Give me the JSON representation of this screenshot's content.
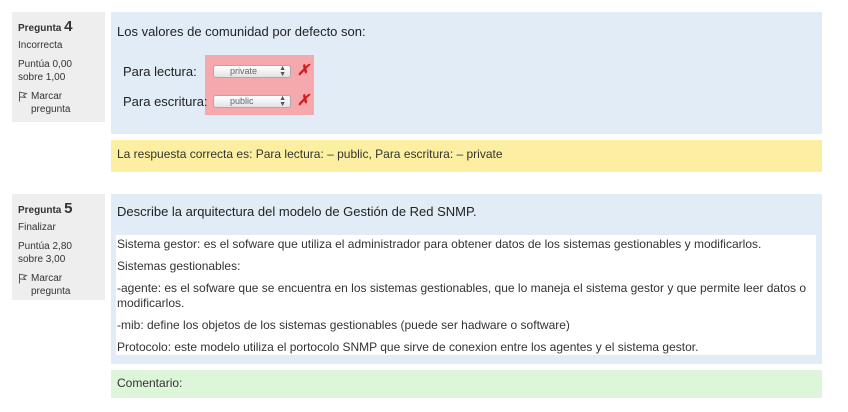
{
  "q4": {
    "label": "Pregunta",
    "number": "4",
    "state": "Incorrecta",
    "grade": "Puntúa 0,00 sobre 1,00",
    "flag_label": "Marcar pregunta",
    "question_text": "Los valores de comunidad por defecto son:",
    "rows": [
      {
        "label": "Para lectura:",
        "selected": "private",
        "mark": "✗"
      },
      {
        "label": "Para escritura:",
        "selected": "public",
        "mark": "✗"
      }
    ],
    "feedback": "La respuesta correcta es: Para lectura: – public, Para escritura: – private"
  },
  "q5": {
    "label": "Pregunta",
    "number": "5",
    "state": "Finalizar",
    "grade": "Puntúa 2,80 sobre 3,00",
    "flag_label": "Marcar pregunta",
    "question_text": "Describe la arquitectura del modelo de Gestión de Red SNMP.",
    "answer_paragraphs": [
      "Sistema gestor: es el sofware que utiliza el administrador para obtener datos de los sistemas gestionables y modificarlos.",
      "Sistemas gestionables:",
      "-agente: es el sofware que se encuentra en los sistemas gestionables, que lo maneja el sistema gestor y que permite leer datos o modificarlos.",
      "-mib: define los objetos de los sistemas gestionables (puede ser hadware o software)",
      "Protocolo: este modelo utiliza el portocolo SNMP que sirve de conexion entre los agentes y el sistema gestor."
    ],
    "comment_label": "Comentario:"
  },
  "colors": {
    "info_bg": "#eeeeee",
    "content_bg": "#e1ecf7",
    "incorrect_bg": "#f6a9ad",
    "feedback_bg": "#fcefa1",
    "comment_bg": "#ddf5d8",
    "incorrect_mark": "#d41a1a"
  }
}
